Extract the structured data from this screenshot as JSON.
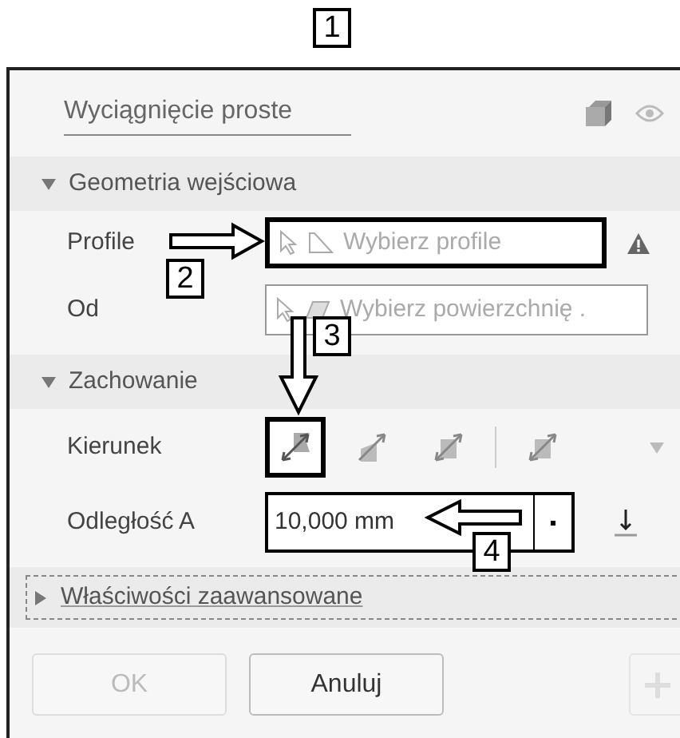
{
  "callouts": [
    {
      "label": "1"
    },
    {
      "label": "2"
    },
    {
      "label": "3"
    },
    {
      "label": "4"
    }
  ],
  "panel": {
    "title": "Wyciągnięcie proste",
    "sections": [
      {
        "kind": "group",
        "title": "Geometria wejściowa",
        "expanded": true,
        "rows": [
          {
            "kind": "select",
            "label": "Profile",
            "placeholder": "Wybierz profile",
            "highlighted": true,
            "warning": true
          },
          {
            "kind": "select",
            "label": "Od",
            "placeholder": "Wybierz powierzchnię .",
            "highlighted": false,
            "warning": false
          }
        ]
      },
      {
        "kind": "group",
        "title": "Zachowanie",
        "expanded": true,
        "rows": [
          {
            "kind": "direction",
            "label": "Kierunek",
            "options": [
              {
                "selected": true,
                "highlighted": true
              },
              {
                "selected": false,
                "highlighted": false
              },
              {
                "selected": false,
                "highlighted": false
              },
              {
                "selected": false,
                "highlighted": false
              }
            ]
          },
          {
            "kind": "value",
            "label": "Odległość A",
            "value": "10,000 mm",
            "highlighted": true
          }
        ]
      },
      {
        "kind": "advanced",
        "title": "Właściwości zaawansowane",
        "expanded": false
      }
    ],
    "buttons": [
      {
        "label": "OK",
        "disabled": true
      },
      {
        "label": "Anuluj",
        "disabled": false
      }
    ]
  }
}
